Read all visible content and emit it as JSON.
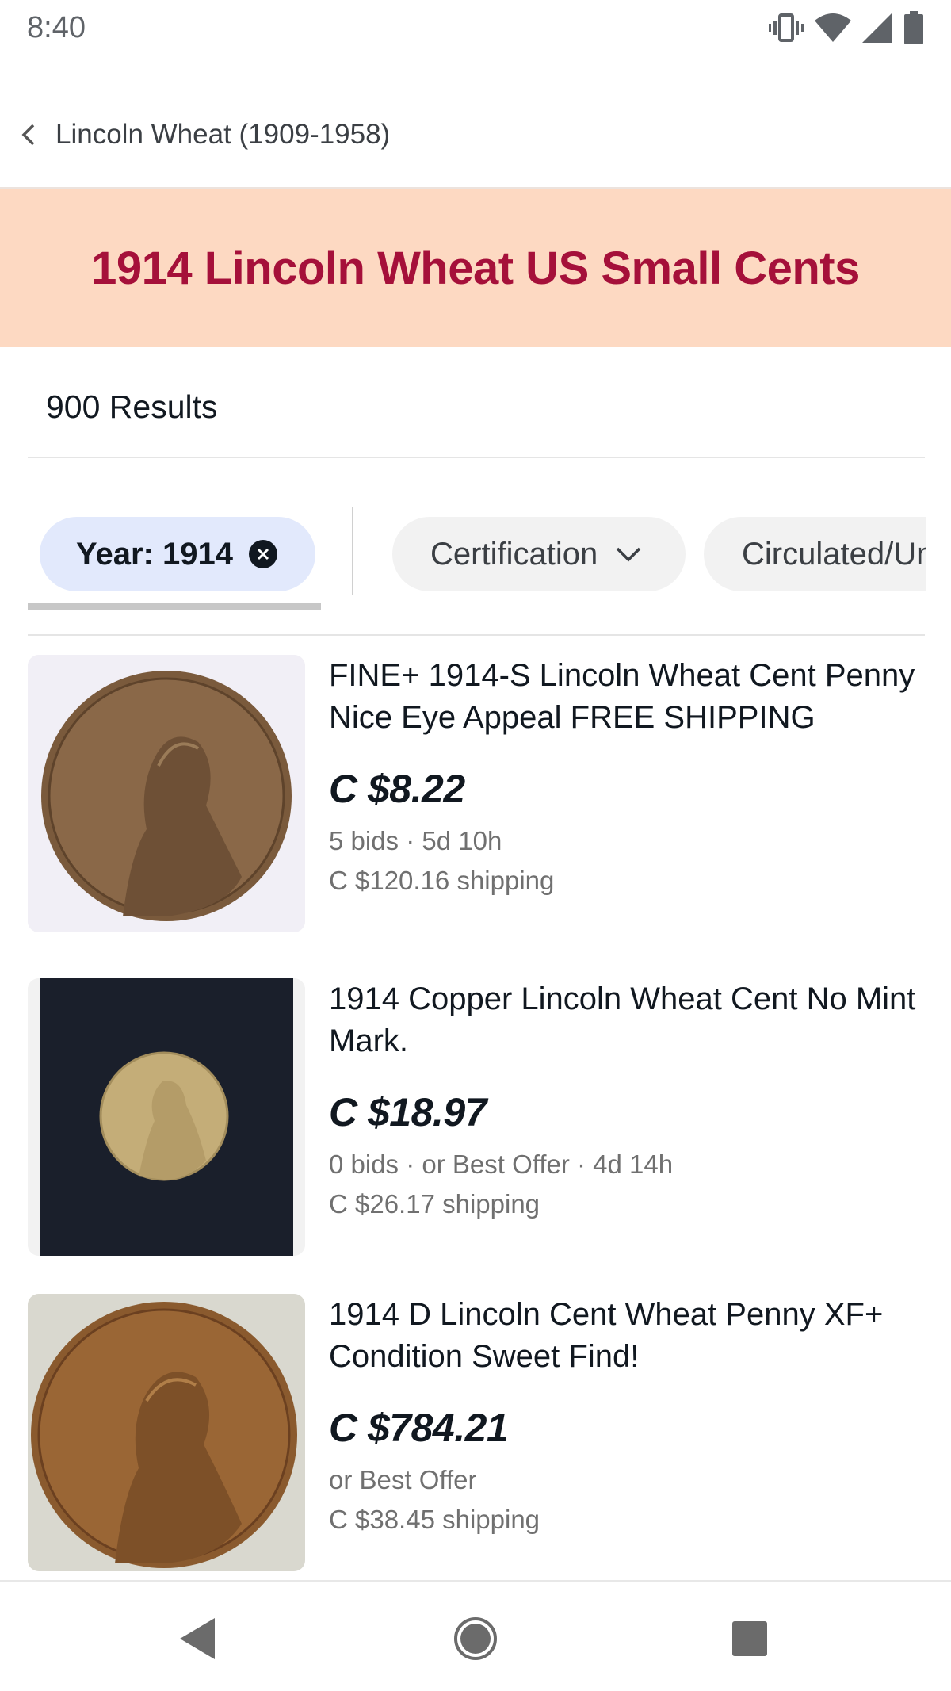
{
  "status_bar": {
    "time": "8:40",
    "icons": [
      "vibrate-icon",
      "wifi-icon",
      "signal-icon",
      "battery-icon"
    ]
  },
  "header": {
    "back_label": "Lincoln Wheat (1909-1958)",
    "back_icon": "chevron-left-icon"
  },
  "banner": {
    "title": "1914 Lincoln Wheat US Small Cents",
    "background": "#fdd9c2",
    "title_color": "#a5103a"
  },
  "results": {
    "count_label": "900 Results"
  },
  "filters": {
    "active": {
      "label": "Year: 1914",
      "clear_icon": "close-circle-icon",
      "background": "#e2e9fc"
    },
    "chips": [
      {
        "label": "Certification",
        "icon": "chevron-down-icon"
      },
      {
        "label": "Circulated/Uncirculated"
      }
    ]
  },
  "listings": [
    {
      "title": "FINE+ 1914-S Lincoln Wheat Cent Penny Nice Eye Appeal FREE SHIPPING",
      "price": "C $8.22",
      "meta": "5 bids · 5d 10h",
      "shipping": "C $120.16 shipping",
      "image": "coin-photo-1914-s"
    },
    {
      "title": "1914 Copper Lincoln Wheat Cent No Mint Mark.",
      "price": "C $18.97",
      "meta": "0 bids · or Best Offer · 4d 14h",
      "shipping": "C $26.17 shipping",
      "image": "coin-photo-on-dark-cloth"
    },
    {
      "title": "1914 D Lincoln Cent Wheat Penny XF+ Condition Sweet Find!",
      "price": "C $784.21",
      "meta": "or Best Offer",
      "shipping": "C $38.45 shipping",
      "image": "coin-photo-1914-d"
    }
  ],
  "nav_bar": {
    "buttons": [
      "back-triangle-icon",
      "home-circle-icon",
      "recents-square-icon"
    ]
  }
}
